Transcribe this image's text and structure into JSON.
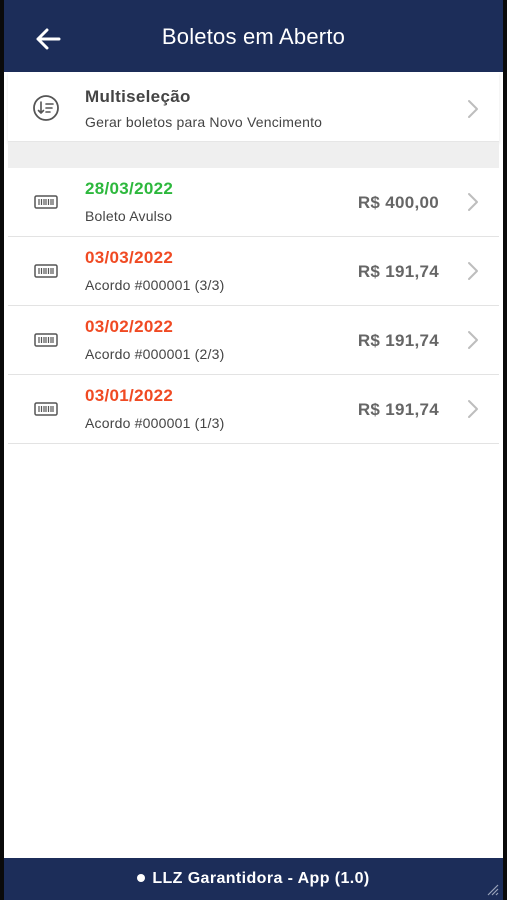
{
  "header": {
    "title": "Boletos em Aberto",
    "back_icon": "arrow-left-icon"
  },
  "multiselect": {
    "title": "Multiseleção",
    "subtitle": "Gerar boletos para Novo Vencimento",
    "icon": "sort-list-icon"
  },
  "boletos": [
    {
      "date": "28/03/2022",
      "description": "Boleto Avulso",
      "amount": "R$ 400,00",
      "status": "ok"
    },
    {
      "date": "03/03/2022",
      "description": "Acordo #000001 (3/3)",
      "amount": "R$ 191,74",
      "status": "overdue"
    },
    {
      "date": "03/02/2022",
      "description": "Acordo #000001 (2/3)",
      "amount": "R$ 191,74",
      "status": "overdue"
    },
    {
      "date": "03/01/2022",
      "description": "Acordo #000001 (1/3)",
      "amount": "R$ 191,74",
      "status": "overdue"
    }
  ],
  "footer": {
    "label": "LLZ Garantidora - App (1.0)"
  },
  "colors": {
    "header_bg": "#1c2d59",
    "date_ok": "#2db83d",
    "date_overdue": "#f04a23",
    "amount": "#666666"
  }
}
